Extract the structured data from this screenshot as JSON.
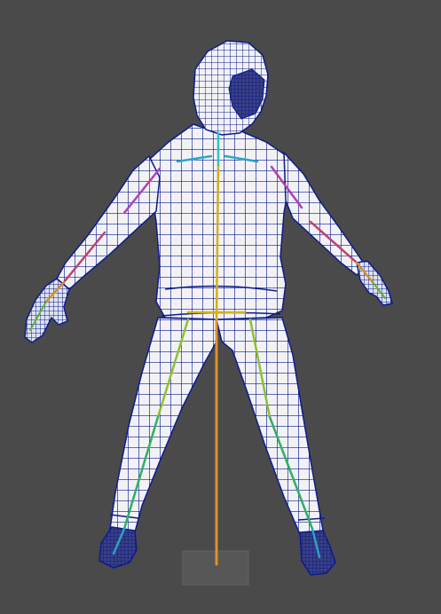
{
  "viewport": {
    "background": "#4a4a4a",
    "mesh_fill": "#f2f2f5",
    "wire_color": "#0d1b8c",
    "ground_color": "#5c5c5c"
  },
  "skeleton": {
    "spine_color": "#e0902a",
    "neck_color": "#2ec4c4",
    "collar_color": "#2aa6c8",
    "upper_arm_color": "#b040b8",
    "forearm_color": "#c04070",
    "hand_color": "#d09030",
    "finger_color": "#58b040",
    "hip_color": "#d0b020",
    "thigh_color": "#90c030",
    "shin_color": "#30b060",
    "foot_color": "#30a0c0"
  }
}
